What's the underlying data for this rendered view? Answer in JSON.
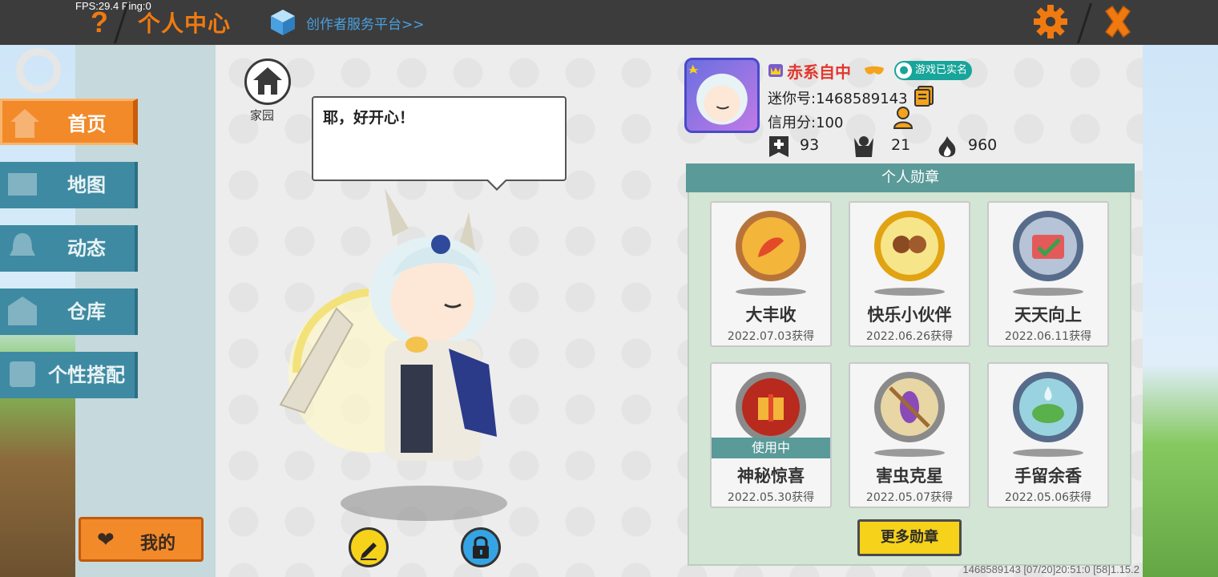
{
  "overlay": {
    "fps": "FPS:29.4  Ping:0"
  },
  "header": {
    "help_glyph": "?",
    "title": "个人中心",
    "platform_link": "创作者服务平台>>",
    "colors": {
      "accent": "#f07a10",
      "bar": "#3c3c3c",
      "link": "#4aa0e0"
    }
  },
  "sidebar": {
    "items": [
      {
        "label": "首页",
        "active": true
      },
      {
        "label": "地图",
        "active": false
      },
      {
        "label": "动态",
        "active": false
      },
      {
        "label": "仓库",
        "active": false
      },
      {
        "label": "个性搭配",
        "active": false
      }
    ],
    "my_button": "我的"
  },
  "stage": {
    "home_label": "家园",
    "speech": "耶，好开心！"
  },
  "profile": {
    "name": "赤系自中",
    "realname_badge": "游戏已实名",
    "mini_id": "迷你号:1468589143",
    "credit": "信用分:100",
    "stats": [
      {
        "icon": "plus-icon",
        "value": "93"
      },
      {
        "icon": "fans-icon",
        "value": "21"
      },
      {
        "icon": "fire-icon",
        "value": "960"
      }
    ]
  },
  "badges": {
    "title": "个人勋章",
    "items": [
      {
        "name": "大丰收",
        "date": "2022.07.03获得",
        "in_use": false
      },
      {
        "name": "快乐小伙伴",
        "date": "2022.06.26获得",
        "in_use": false
      },
      {
        "name": "天天向上",
        "date": "2022.06.11获得",
        "in_use": false
      },
      {
        "name": "神秘惊喜",
        "date": "2022.05.30获得",
        "in_use": true,
        "in_use_label": "使用中"
      },
      {
        "name": "害虫克星",
        "date": "2022.05.07获得",
        "in_use": false
      },
      {
        "name": "手留余香",
        "date": "2022.05.06获得",
        "in_use": false
      }
    ],
    "more_button": "更多勋章"
  },
  "footer": {
    "info": "1468589143    [07/20]20:51:0   [58]1.15.2"
  }
}
